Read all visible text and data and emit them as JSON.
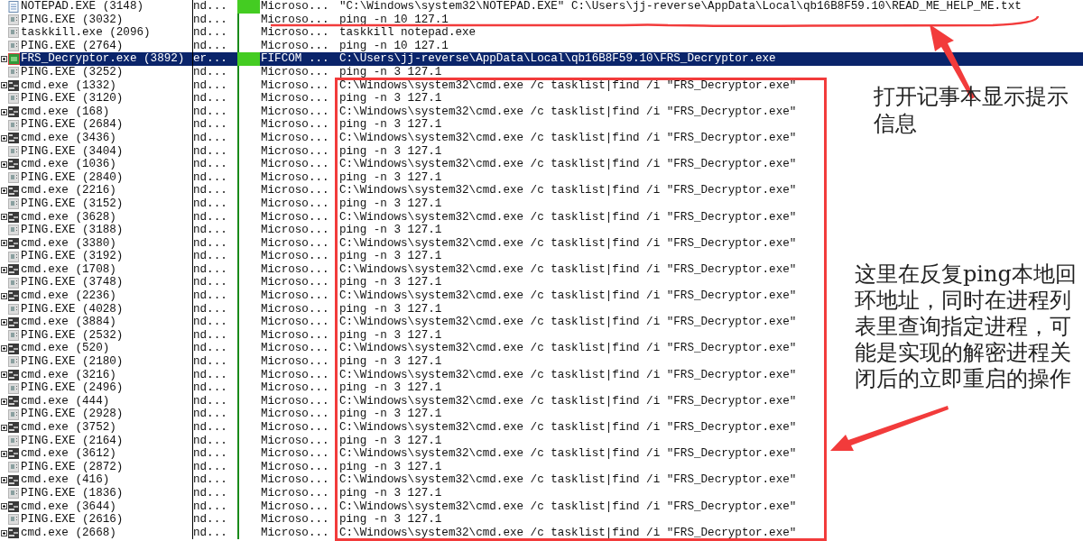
{
  "rows": [
    {
      "name": "NOTEPAD.EXE (3148)",
      "kind": "notepad",
      "column_2": "nd...",
      "company": "Microso...",
      "command": "\"C:\\Windows\\system32\\NOTEPAD.EXE\" C:\\Users\\jj-reverse\\AppData\\Local\\qb16B8F59.10\\READ_ME_HELP_ME.txt",
      "selected": false
    },
    {
      "name": "PING.EXE (3032)",
      "kind": "ping",
      "column_2": "nd...",
      "company": "Microso...",
      "command": "ping  -n 10 127.1",
      "selected": false
    },
    {
      "name": "taskkill.exe (2096)",
      "kind": "ping",
      "column_2": "nd...",
      "company": "Microso...",
      "command": "taskkill  notepad.exe",
      "selected": false
    },
    {
      "name": "PING.EXE (2764)",
      "kind": "ping",
      "column_2": "nd...",
      "company": "Microso...",
      "command": "ping  -n 10 127.1",
      "selected": false
    },
    {
      "name": "FRS_Decryptor.exe (3892)",
      "kind": "frs",
      "column_2": "er...",
      "company": "FIFCOM ...",
      "command": "C:\\Users\\jj-reverse\\AppData\\Local\\qb16B8F59.10\\FRS_Decryptor.exe",
      "selected": true
    },
    {
      "name": "PING.EXE (3252)",
      "kind": "ping",
      "column_2": "nd...",
      "company": "Microso...",
      "command": "ping  -n 3 127.1",
      "selected": false
    },
    {
      "name": "cmd.exe (1332)",
      "kind": "cmd",
      "column_2": "nd...",
      "company": "Microso...",
      "command": "C:\\Windows\\system32\\cmd.exe /c tasklist|find /i \"FRS_Decryptor.exe\"",
      "selected": false
    },
    {
      "name": "PING.EXE (3120)",
      "kind": "ping",
      "column_2": "nd...",
      "company": "Microso...",
      "command": "ping  -n 3 127.1",
      "selected": false
    },
    {
      "name": "cmd.exe (168)",
      "kind": "cmd",
      "column_2": "nd...",
      "company": "Microso...",
      "command": "C:\\Windows\\system32\\cmd.exe /c tasklist|find /i \"FRS_Decryptor.exe\"",
      "selected": false
    },
    {
      "name": "PING.EXE (2684)",
      "kind": "ping",
      "column_2": "nd...",
      "company": "Microso...",
      "command": "ping  -n 3 127.1",
      "selected": false
    },
    {
      "name": "cmd.exe (3436)",
      "kind": "cmd",
      "column_2": "nd...",
      "company": "Microso...",
      "command": "C:\\Windows\\system32\\cmd.exe /c tasklist|find /i \"FRS_Decryptor.exe\"",
      "selected": false
    },
    {
      "name": "PING.EXE (3404)",
      "kind": "ping",
      "column_2": "nd...",
      "company": "Microso...",
      "command": "ping  -n 3 127.1",
      "selected": false
    },
    {
      "name": "cmd.exe (1036)",
      "kind": "cmd",
      "column_2": "nd...",
      "company": "Microso...",
      "command": "C:\\Windows\\system32\\cmd.exe /c tasklist|find /i \"FRS_Decryptor.exe\"",
      "selected": false
    },
    {
      "name": "PING.EXE (2840)",
      "kind": "ping",
      "column_2": "nd...",
      "company": "Microso...",
      "command": "ping  -n 3 127.1",
      "selected": false
    },
    {
      "name": "cmd.exe (2216)",
      "kind": "cmd",
      "column_2": "nd...",
      "company": "Microso...",
      "command": "C:\\Windows\\system32\\cmd.exe /c tasklist|find /i \"FRS_Decryptor.exe\"",
      "selected": false
    },
    {
      "name": "PING.EXE (3152)",
      "kind": "ping",
      "column_2": "nd...",
      "company": "Microso...",
      "command": "ping  -n 3 127.1",
      "selected": false
    },
    {
      "name": "cmd.exe (3628)",
      "kind": "cmd",
      "column_2": "nd...",
      "company": "Microso...",
      "command": "C:\\Windows\\system32\\cmd.exe /c tasklist|find /i \"FRS_Decryptor.exe\"",
      "selected": false
    },
    {
      "name": "PING.EXE (3188)",
      "kind": "ping",
      "column_2": "nd...",
      "company": "Microso...",
      "command": "ping  -n 3 127.1",
      "selected": false
    },
    {
      "name": "cmd.exe (3380)",
      "kind": "cmd",
      "column_2": "nd...",
      "company": "Microso...",
      "command": "C:\\Windows\\system32\\cmd.exe /c tasklist|find /i \"FRS_Decryptor.exe\"",
      "selected": false
    },
    {
      "name": "PING.EXE (3192)",
      "kind": "ping",
      "column_2": "nd...",
      "company": "Microso...",
      "command": "ping  -n 3 127.1",
      "selected": false
    },
    {
      "name": "cmd.exe (1708)",
      "kind": "cmd",
      "column_2": "nd...",
      "company": "Microso...",
      "command": "C:\\Windows\\system32\\cmd.exe /c tasklist|find /i \"FRS_Decryptor.exe\"",
      "selected": false
    },
    {
      "name": "PING.EXE (3748)",
      "kind": "ping",
      "column_2": "nd...",
      "company": "Microso...",
      "command": "ping  -n 3 127.1",
      "selected": false
    },
    {
      "name": "cmd.exe (2236)",
      "kind": "cmd",
      "column_2": "nd...",
      "company": "Microso...",
      "command": "C:\\Windows\\system32\\cmd.exe /c tasklist|find /i \"FRS_Decryptor.exe\"",
      "selected": false
    },
    {
      "name": "PING.EXE (4028)",
      "kind": "ping",
      "column_2": "nd...",
      "company": "Microso...",
      "command": "ping  -n 3 127.1",
      "selected": false
    },
    {
      "name": "cmd.exe (3884)",
      "kind": "cmd",
      "column_2": "nd...",
      "company": "Microso...",
      "command": "C:\\Windows\\system32\\cmd.exe /c tasklist|find /i \"FRS_Decryptor.exe\"",
      "selected": false
    },
    {
      "name": "PING.EXE (2532)",
      "kind": "ping",
      "column_2": "nd...",
      "company": "Microso...",
      "command": "ping  -n 3 127.1",
      "selected": false
    },
    {
      "name": "cmd.exe (520)",
      "kind": "cmd",
      "column_2": "nd...",
      "company": "Microso...",
      "command": "C:\\Windows\\system32\\cmd.exe /c tasklist|find /i \"FRS_Decryptor.exe\"",
      "selected": false
    },
    {
      "name": "PING.EXE (2180)",
      "kind": "ping",
      "column_2": "nd...",
      "company": "Microso...",
      "command": "ping  -n 3 127.1",
      "selected": false
    },
    {
      "name": "cmd.exe (3216)",
      "kind": "cmd",
      "column_2": "nd...",
      "company": "Microso...",
      "command": "C:\\Windows\\system32\\cmd.exe /c tasklist|find /i \"FRS_Decryptor.exe\"",
      "selected": false
    },
    {
      "name": "PING.EXE (2496)",
      "kind": "ping",
      "column_2": "nd...",
      "company": "Microso...",
      "command": "ping  -n 3 127.1",
      "selected": false
    },
    {
      "name": "cmd.exe (444)",
      "kind": "cmd",
      "column_2": "nd...",
      "company": "Microso...",
      "command": "C:\\Windows\\system32\\cmd.exe /c tasklist|find /i \"FRS_Decryptor.exe\"",
      "selected": false
    },
    {
      "name": "PING.EXE (2928)",
      "kind": "ping",
      "column_2": "nd...",
      "company": "Microso...",
      "command": "ping  -n 3 127.1",
      "selected": false
    },
    {
      "name": "cmd.exe (3752)",
      "kind": "cmd",
      "column_2": "nd...",
      "company": "Microso...",
      "command": "C:\\Windows\\system32\\cmd.exe /c tasklist|find /i \"FRS_Decryptor.exe\"",
      "selected": false
    },
    {
      "name": "PING.EXE (2164)",
      "kind": "ping",
      "column_2": "nd...",
      "company": "Microso...",
      "command": "ping  -n 3 127.1",
      "selected": false
    },
    {
      "name": "cmd.exe (3612)",
      "kind": "cmd",
      "column_2": "nd...",
      "company": "Microso...",
      "command": "C:\\Windows\\system32\\cmd.exe /c tasklist|find /i \"FRS_Decryptor.exe\"",
      "selected": false
    },
    {
      "name": "PING.EXE (2872)",
      "kind": "ping",
      "column_2": "nd...",
      "company": "Microso...",
      "command": "ping  -n 3 127.1",
      "selected": false
    },
    {
      "name": "cmd.exe (416)",
      "kind": "cmd",
      "column_2": "nd...",
      "company": "Microso...",
      "command": "C:\\Windows\\system32\\cmd.exe /c tasklist|find /i \"FRS_Decryptor.exe\"",
      "selected": false
    },
    {
      "name": "PING.EXE (1836)",
      "kind": "ping",
      "column_2": "nd...",
      "company": "Microso...",
      "command": "ping  -n 3 127.1",
      "selected": false
    },
    {
      "name": "cmd.exe (3644)",
      "kind": "cmd",
      "column_2": "nd...",
      "company": "Microso...",
      "command": "C:\\Windows\\system32\\cmd.exe /c tasklist|find /i \"FRS_Decryptor.exe\"",
      "selected": false
    },
    {
      "name": "PING.EXE (2616)",
      "kind": "ping",
      "column_2": "nd...",
      "company": "Microso...",
      "command": "ping  -n 3 127.1",
      "selected": false
    },
    {
      "name": "cmd.exe (2668)",
      "kind": "cmd",
      "column_2": "nd...",
      "company": "Microso...",
      "command": "C:\\Windows\\system32\\cmd.exe /c tasklist|find /i \"FRS_Decryptor.exe\"",
      "selected": false
    }
  ],
  "annotations": [
    {
      "text": "打开记事本显示提示信息"
    },
    {
      "text": "这里在反复ping本地回环地址，同时在进程列表里查询指定进程，可能是实现的解密进程关闭后的立即重启的操作"
    }
  ]
}
